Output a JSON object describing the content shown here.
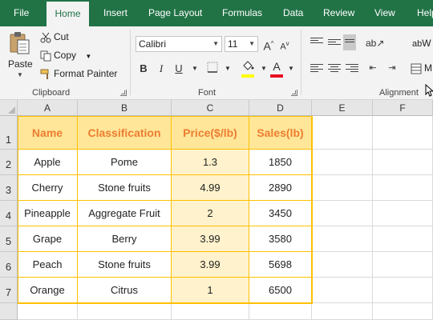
{
  "tabs": [
    {
      "label": "File",
      "active": false
    },
    {
      "label": "Home",
      "active": true
    },
    {
      "label": "Insert",
      "active": false
    },
    {
      "label": "Page Layout",
      "active": false
    },
    {
      "label": "Formulas",
      "active": false
    },
    {
      "label": "Data",
      "active": false
    },
    {
      "label": "Review",
      "active": false
    },
    {
      "label": "View",
      "active": false
    },
    {
      "label": "Help",
      "active": false
    }
  ],
  "ribbon": {
    "clipboard": {
      "paste_label": "Paste",
      "cut_label": "Cut",
      "copy_label": "Copy",
      "format_painter_label": "Format Painter",
      "group_label": "Clipboard"
    },
    "font": {
      "font_name": "Calibri",
      "font_size": "11",
      "bold": "B",
      "italic": "I",
      "underline": "U",
      "grow_font": "A",
      "shrink_font": "A",
      "font_color_glyph": "A",
      "fill_color": "#ffff00",
      "font_color": "#e81123",
      "group_label": "Font"
    },
    "alignment": {
      "group_label": "Alignment",
      "wrap_label": "W",
      "merge_label": "M"
    }
  },
  "sheet": {
    "columns": [
      "A",
      "B",
      "C",
      "D",
      "E",
      "F"
    ],
    "rows": [
      "1",
      "2",
      "3",
      "4",
      "5",
      "6",
      "7"
    ],
    "header_fill": "#ffe699",
    "body_fill": "#fff2cc",
    "border_color": "#ffc000",
    "header_text_color": "#ed7d31",
    "table": {
      "headers": [
        "Name",
        "Classification",
        "Price($/lb)",
        "Sales(lb)"
      ],
      "rows": [
        [
          "Apple",
          "Pome",
          "1.3",
          "1850"
        ],
        [
          "Cherry",
          "Stone fruits",
          "4.99",
          "2890"
        ],
        [
          "Pineapple",
          "Aggregate Fruit",
          "2",
          "3450"
        ],
        [
          "Grape",
          "Berry",
          "3.99",
          "3580"
        ],
        [
          "Peach",
          "Stone fruits",
          "3.99",
          "5698"
        ],
        [
          "Orange",
          "Citrus",
          "1",
          "6500"
        ]
      ]
    }
  },
  "colors": {
    "excel_green": "#217346",
    "ribbon_bg": "#f3f3f3"
  }
}
